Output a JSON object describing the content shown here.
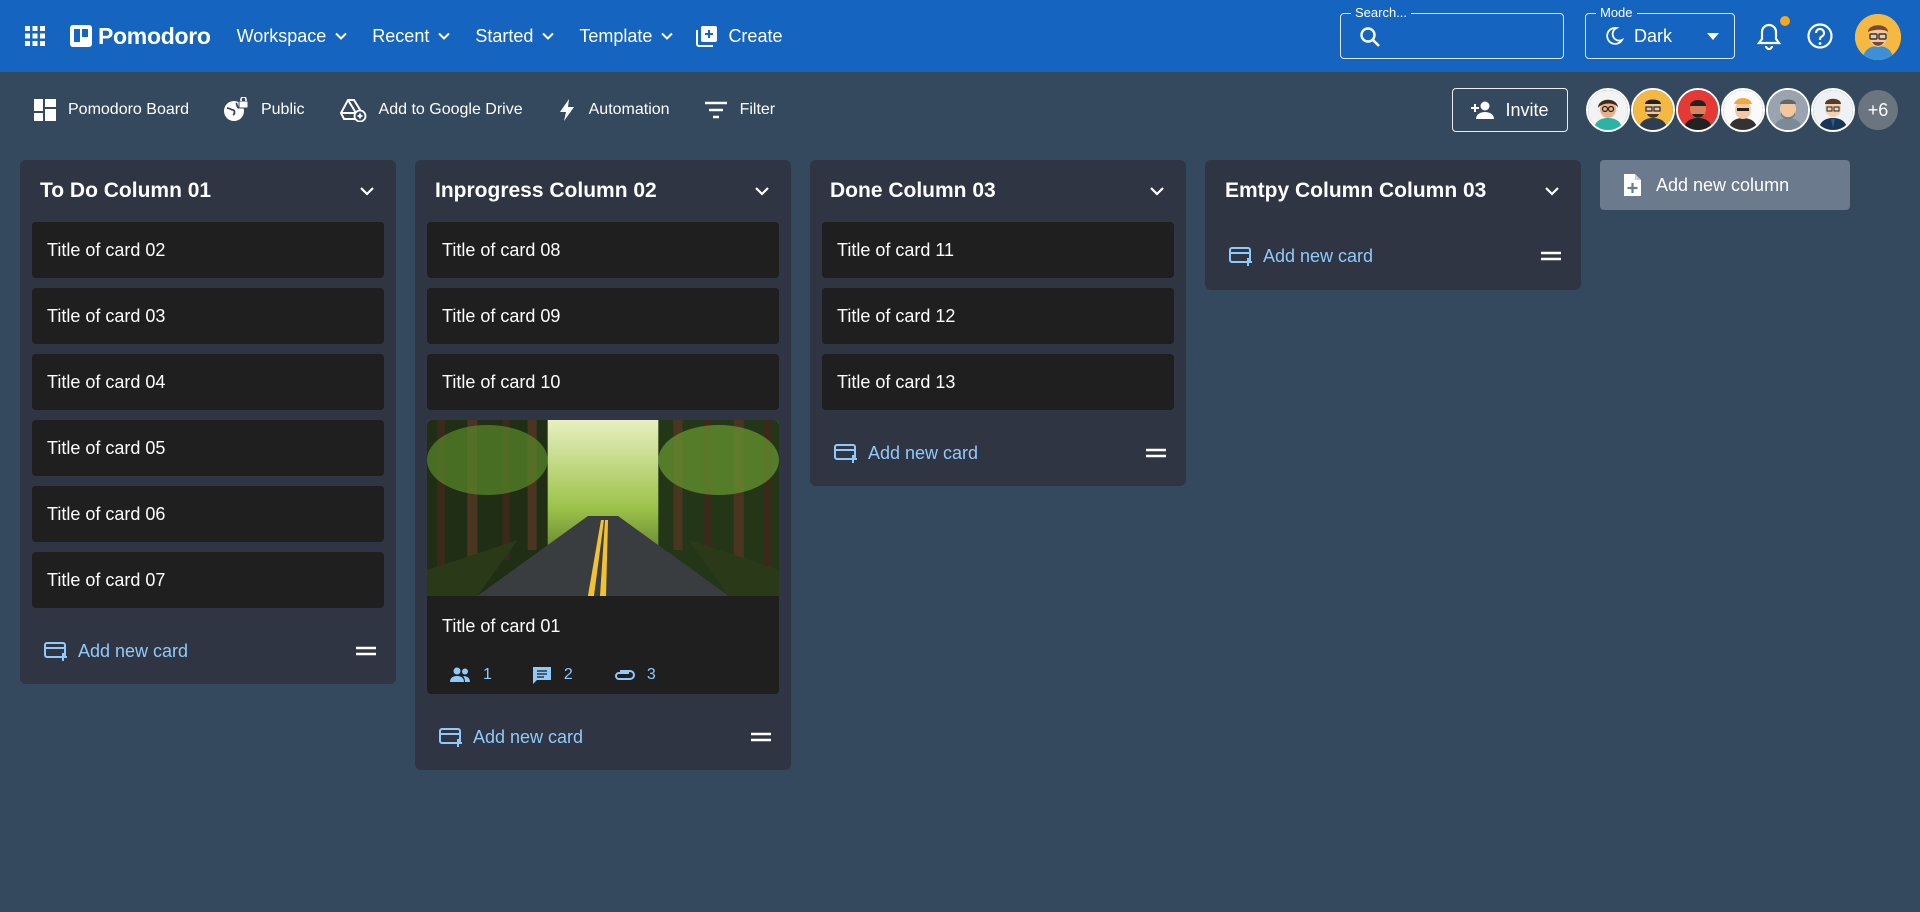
{
  "appbar": {
    "app_name": "Pomodoro",
    "nav": [
      {
        "label": "Workspace"
      },
      {
        "label": "Recent"
      },
      {
        "label": "Started"
      },
      {
        "label": "Template"
      }
    ],
    "create_label": "Create",
    "search": {
      "legend": "Search...",
      "value": "",
      "placeholder": ""
    },
    "mode": {
      "legend": "Mode",
      "value": "Dark"
    },
    "notification_badge_color": "#f5a623"
  },
  "toolbar": {
    "board_label": "Pomodoro Board",
    "visibility_label": "Public",
    "drive_label": "Add to Google Drive",
    "automation_label": "Automation",
    "filter_label": "Filter",
    "invite_label": "Invite",
    "more_members": "+6"
  },
  "columns": [
    {
      "title": "To Do Column 01",
      "cards": [
        "Title of card 02",
        "Title of card 03",
        "Title of card 04",
        "Title of card 05",
        "Title of card 06",
        "Title of card 07"
      ],
      "add_label": "Add new card"
    },
    {
      "title": "Inprogress Column 02",
      "cards": [
        "Title of card 08",
        "Title of card 09",
        "Title of card 10"
      ],
      "cover_card": {
        "title": "Title of card 01",
        "members": "1",
        "comments": "2",
        "attachments": "3"
      },
      "add_label": "Add new card"
    },
    {
      "title": "Done Column 03",
      "cards": [
        "Title of card 11",
        "Title of card 12",
        "Title of card 13"
      ],
      "add_label": "Add new card"
    },
    {
      "title": "Emtpy Column Column 03",
      "cards": [],
      "add_label": "Add new card"
    }
  ],
  "add_column_label": "Add new column",
  "colors": {
    "appbar": "#1565c0",
    "board_bg": "#34495e",
    "column_bg": "#2f3542",
    "card_bg": "#1f1f1f",
    "accent_link": "#90caf9"
  }
}
